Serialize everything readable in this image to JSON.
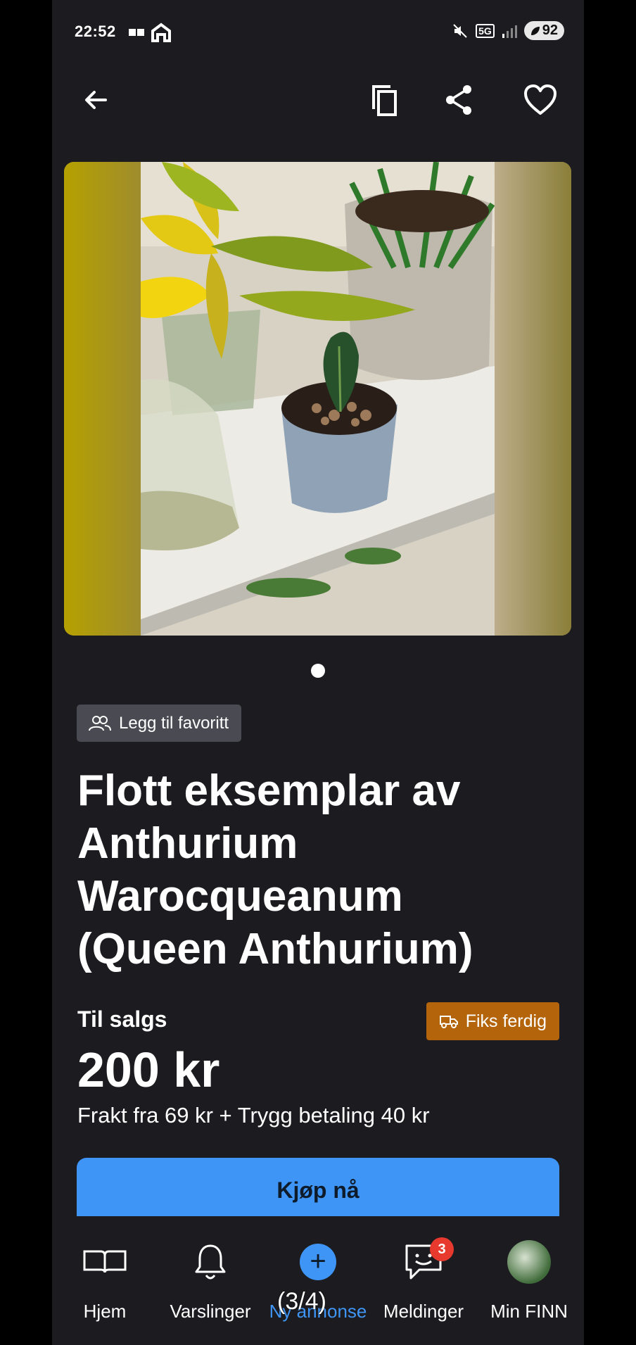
{
  "status_bar": {
    "time": "22:52",
    "battery": "92",
    "network": "5G"
  },
  "actions": {
    "back": "arrow-left-icon",
    "copy": "copy-icon",
    "share": "share-icon",
    "favorite": "heart-icon"
  },
  "gallery": {
    "image_count": 1,
    "current": 1
  },
  "listing": {
    "favorite_chip_label": "Legg til favoritt",
    "title": "Flott eksemplar av Anthurium Warocqueanum (Queen Anthurium)",
    "sale_type": "Til salgs",
    "fiks_ferdig_label": "Fiks ferdig",
    "price": "200 kr",
    "shipping": "Frakt fra 69 kr + Trygg betaling 40 kr",
    "buy_label": "Kjøp nå"
  },
  "nav": {
    "items": [
      {
        "label": "Hjem",
        "icon": "book-icon"
      },
      {
        "label": "Varslinger",
        "icon": "bell-icon"
      },
      {
        "label": "Ny annonse",
        "icon": "plus-icon"
      },
      {
        "label": "Meldinger",
        "icon": "chat-icon",
        "badge": "3"
      },
      {
        "label": "Min FINN",
        "icon": "avatar"
      }
    ],
    "active_index": 2
  },
  "overlay": {
    "pager": "(3/4)"
  },
  "colors": {
    "background": "#1c1c20",
    "accent": "#3f95f5",
    "fiks_ferdig": "#b4640a",
    "badge": "#e8392e"
  }
}
